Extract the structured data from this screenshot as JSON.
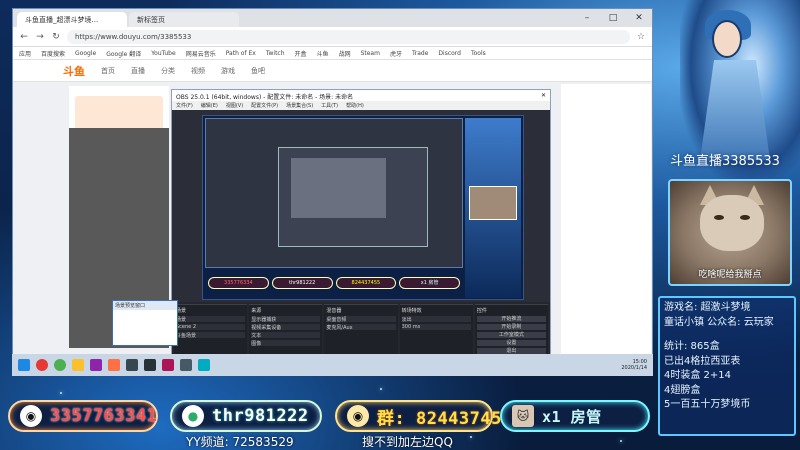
{
  "browser": {
    "tabs": [
      "斗鱼直播_超漂斗梦境...",
      "新标签页"
    ],
    "url": "https://www.douyu.com/3385533",
    "bookmarks": [
      "应用",
      "百度搜索",
      "Google",
      "Google 翻译",
      "YouTube",
      "网易云音乐",
      "Path of Ex",
      "Twitch",
      "开盒",
      "斗鱼",
      "战网",
      "Steam",
      "虎牙",
      "Trade",
      "Discord",
      "Tools"
    ],
    "site_menu": [
      "首页",
      "直播",
      "分类",
      "视频",
      "游戏",
      "鱼吧"
    ],
    "site_logo": "斗鱼"
  },
  "obs": {
    "title": "OBS 25.0.1 (64bit, windows) - 配置文件: 未命名 - 场景: 未命名",
    "menu": [
      "文件(F)",
      "编辑(E)",
      "视图(V)",
      "配置文件(P)",
      "场景集合(S)",
      "工具(T)",
      "帮助(H)"
    ],
    "docks": [
      {
        "title": "场景",
        "rows": [
          "场景",
          "Scene 2",
          "斗鱼场景"
        ]
      },
      {
        "title": "来源",
        "rows": [
          "显示器捕获",
          "视频采集设备",
          "文本",
          "图像"
        ]
      },
      {
        "title": "混音器",
        "rows": [
          "桌面音频",
          "麦克风/Aux"
        ]
      },
      {
        "title": "转场特效",
        "rows": [
          "淡出",
          "300 ms"
        ]
      },
      {
        "title": "控件",
        "rows": [
          "开始推流",
          "开始录制",
          "工作室模式",
          "设置",
          "退出"
        ]
      }
    ],
    "preview_pills": [
      "335776334",
      "thr981222",
      "824437455",
      "x1 房管"
    ]
  },
  "thumbnail": {
    "title": "场景预览窗口"
  },
  "taskbar": {
    "clock_time": "15:00",
    "clock_date": "2020/1/14"
  },
  "streamer": {
    "platform_room": "斗鱼直播3385533",
    "cam_caption": "吃啥呢给我掰点",
    "info_lines": [
      "游戏名: 超激斗梦境",
      "童话小镇 公众名: 云玩家",
      "",
      "统计: 865盒",
      "已出4格拉西亚表",
      "4时装盒 2+14",
      "4翅膀盒",
      "5一百五十万梦境币"
    ]
  },
  "bottom_bar": {
    "qq": "3357763341",
    "wechat": "thr981222",
    "group": "群: 824437455",
    "admin": "x1 房管",
    "yy_channel": "YY频道: 72583529",
    "hint": "搜不到加左边QQ"
  },
  "colors": {
    "accent": "#5cc8ff",
    "qq_red": "#ff4b4b",
    "group_yellow": "#ffe04a"
  }
}
